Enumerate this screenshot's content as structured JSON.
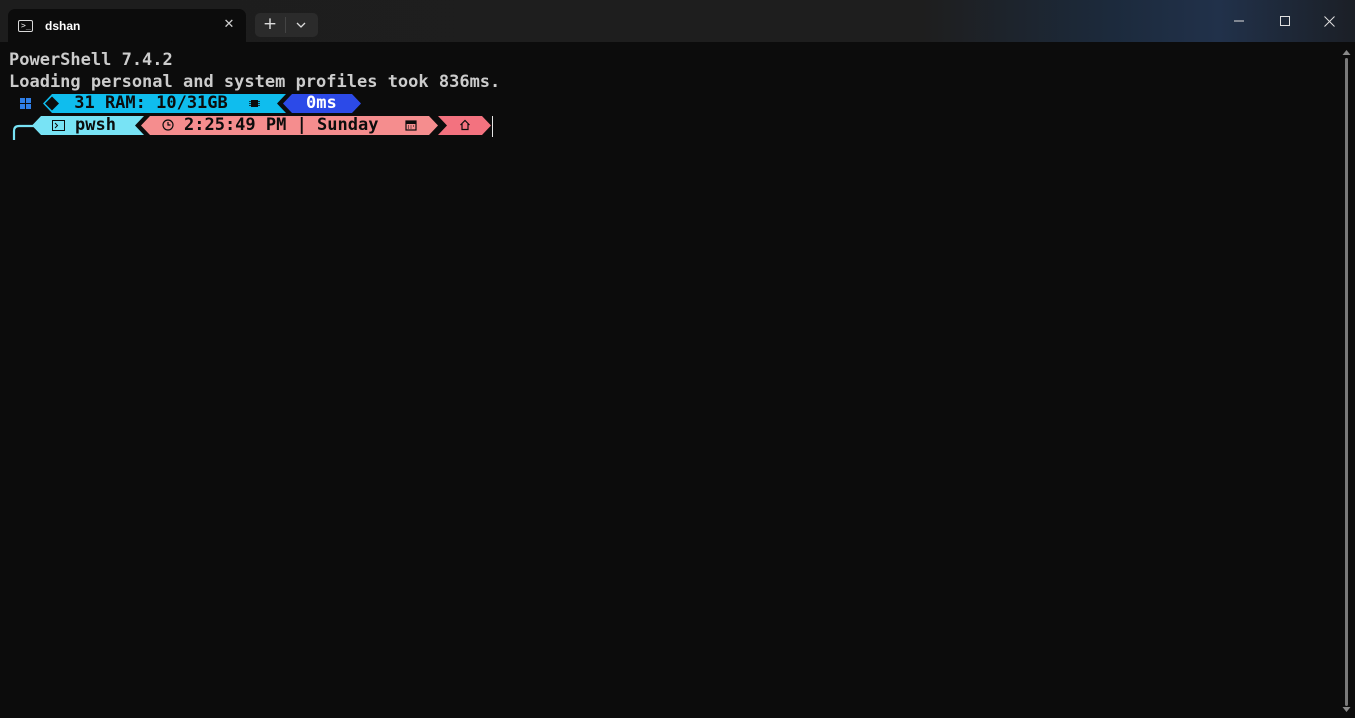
{
  "tab": {
    "title": "dshan",
    "icon": "powershell-icon",
    "close_icon": "close-icon"
  },
  "newtab": {
    "plus_label": "+",
    "dropdown_icon": "chevron-down-icon"
  },
  "window_controls": {
    "minimize_icon": "minimize-icon",
    "maximize_icon": "maximize-icon",
    "close_icon": "close-icon"
  },
  "terminal": {
    "lines": [
      "PowerShell 7.4.2",
      "Loading personal and system profiles took 836ms."
    ],
    "prompt": {
      "os_icon": "windows-logo-icon",
      "ram_text": " 31 RAM: 10/31GB",
      "ram_icon": "chip-icon",
      "exec_time": "0ms",
      "shell": "pwsh",
      "shell_icon": "terminal-icon",
      "time_text": "2:25:49 PM | Sunday",
      "clock_icon": "clock-icon",
      "calendar_icon": "calendar-icon",
      "home_icon": "home-icon"
    }
  },
  "colors": {
    "background": "#0c0c0c",
    "text": "#cccccc",
    "cyan": "#0fbdee",
    "blue": "#2c4ae8",
    "light_cyan": "#78e3f5",
    "salmon": "#f58d8e",
    "pink": "#f3727f"
  }
}
